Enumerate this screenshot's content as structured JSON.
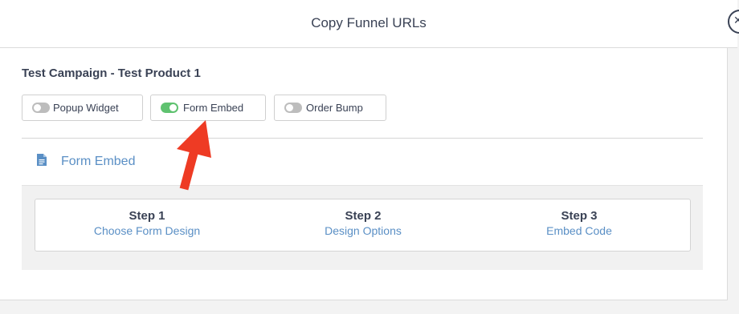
{
  "header": {
    "title": "Copy Funnel URLs"
  },
  "campaign": {
    "title": "Test Campaign - Test Product 1"
  },
  "toggles": [
    {
      "label": "Popup Widget",
      "state": "off"
    },
    {
      "label": "Form Embed",
      "state": "on"
    },
    {
      "label": "Order Bump",
      "state": "off"
    }
  ],
  "section": {
    "title": "Form Embed",
    "icon": "document-icon"
  },
  "steps": [
    {
      "number": "Step 1",
      "name": "Choose Form Design"
    },
    {
      "number": "Step 2",
      "name": "Design Options"
    },
    {
      "number": "Step 3",
      "name": "Embed Code"
    }
  ],
  "colors": {
    "accent_blue": "#5a8fc5",
    "toggle_on": "#5fc270",
    "toggle_off": "#bdbdbd",
    "text_dark": "#3a4255",
    "annotation_arrow": "#ee3b24"
  }
}
